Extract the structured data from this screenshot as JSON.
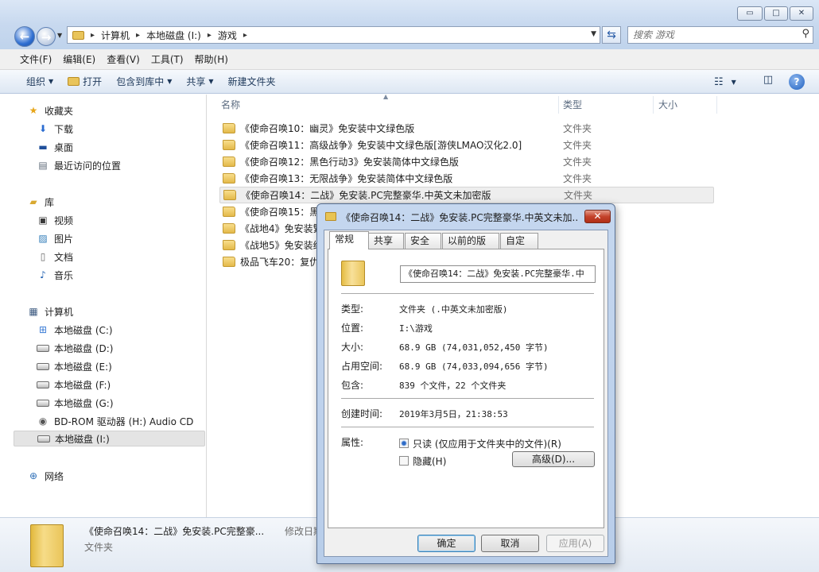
{
  "window": {
    "caption_buttons": {
      "minimize": "▭",
      "maximize": "□",
      "close": "✕"
    }
  },
  "address": {
    "breadcrumbs": [
      "计算机",
      "本地磁盘 (I:)",
      "游戏"
    ],
    "search_placeholder": "搜索 游戏"
  },
  "menubar": [
    "文件(F)",
    "编辑(E)",
    "查看(V)",
    "工具(T)",
    "帮助(H)"
  ],
  "commandbar": {
    "organize": "组织",
    "open": "打开",
    "include_library": "包含到库中",
    "share": "共享",
    "new_folder": "新建文件夹"
  },
  "navpane": {
    "favorites": {
      "label": "收藏夹",
      "items": [
        "下载",
        "桌面",
        "最近访问的位置"
      ]
    },
    "libraries": {
      "label": "库",
      "items": [
        "视频",
        "图片",
        "文档",
        "音乐"
      ]
    },
    "computer": {
      "label": "计算机",
      "items": [
        "本地磁盘 (C:)",
        "本地磁盘 (D:)",
        "本地磁盘 (E:)",
        "本地磁盘 (F:)",
        "本地磁盘 (G:)",
        "BD-ROM 驱动器 (H:) Audio CD",
        "本地磁盘 (I:)"
      ]
    },
    "network": {
      "label": "网络"
    }
  },
  "filelist": {
    "columns": {
      "name": "名称",
      "type": "类型",
      "size": "大小"
    },
    "rows": [
      {
        "name": "《使命召唤10：幽灵》免安装中文绿色版",
        "type": "文件夹"
      },
      {
        "name": "《使命召唤11：高级战争》免安装中文绿色版[游侠LMAO汉化2.0]",
        "type": "文件夹"
      },
      {
        "name": "《使命召唤12：黑色行动3》免安装简体中文绿色版",
        "type": "文件夹"
      },
      {
        "name": "《使命召唤13：无限战争》免安装简体中文绿色版",
        "type": "文件夹"
      },
      {
        "name": "《使命召唤14：二战》免安装.PC完整豪华.中英文未加密版",
        "type": "文件夹"
      },
      {
        "name": "《使命召唤15：黑",
        "type": ""
      },
      {
        "name": "《战地4》免安装繁",
        "type": ""
      },
      {
        "name": "《战地5》免安装绿",
        "type": ""
      },
      {
        "name": "极品飞车20：复仇",
        "type": ""
      }
    ]
  },
  "details": {
    "name": "《使命召唤14：二战》免安装.PC完整豪...",
    "modified_label": "修改日期",
    "type": "文件夹"
  },
  "dialog": {
    "title": "《使命召唤14：二战》免安装.PC完整豪华.中英文未加...",
    "close": "✕",
    "tabs": [
      "常规",
      "共享",
      "安全",
      "以前的版本",
      "自定义"
    ],
    "name_value": "《使命召唤14：二战》免安装.PC完整豪华.中",
    "props": {
      "type_label": "类型:",
      "type_value": "文件夹 (.中英文未加密版)",
      "location_label": "位置:",
      "location_value": "I:\\游戏",
      "size_label": "大小:",
      "size_value": "68.9 GB (74,031,052,450 字节)",
      "disk_label": "占用空间:",
      "disk_value": "68.9 GB (74,033,094,656 字节)",
      "contains_label": "包含:",
      "contains_value": "839 个文件，22 个文件夹",
      "created_label": "创建时间:",
      "created_value": "2019年3月5日，21:38:53",
      "attributes_label": "属性:",
      "readonly_label": "只读 (仅应用于文件夹中的文件)(R)",
      "hidden_label": "隐藏(H)",
      "advanced_button": "高级(D)..."
    },
    "buttons": {
      "ok": "确定",
      "cancel": "取消",
      "apply": "应用(A)"
    }
  }
}
